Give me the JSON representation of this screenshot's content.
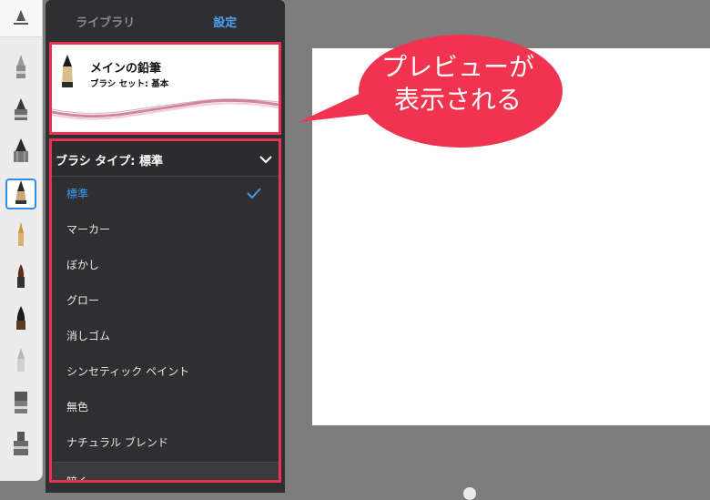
{
  "panel": {
    "tabs": [
      {
        "label": "ライブラリ",
        "active": false
      },
      {
        "label": "設定",
        "active": true
      }
    ],
    "preview": {
      "brush_name": "メインの鉛筆",
      "brush_set": "ブラシ セット: 基本"
    },
    "brush_type": {
      "header": "ブラシ タイプ: 標準",
      "options": [
        "標準",
        "マーカー",
        "ぼかし",
        "グロー",
        "消しゴム",
        "シンセティック ペイント",
        "無色",
        "ナチュラル ブレンド"
      ],
      "selected": "標準",
      "more": "暗く"
    }
  },
  "callout": {
    "line1": "プレビューが",
    "line2": "表示される"
  },
  "toolbar": {
    "icons": [
      "pencil-settings-icon",
      "airbrush-icon",
      "marker-icon",
      "pencil-icon",
      "ballpoint-icon",
      "pen-icon",
      "paintbrush-icon",
      "ink-brush-icon",
      "smudge-icon",
      "eraser-icon",
      "fill-icon"
    ],
    "selected": "ballpoint-icon"
  },
  "colors": {
    "accent": "#3c9af2",
    "highlight": "#e8344e",
    "panel": "#2f2f31",
    "background": "#7d7d7d"
  }
}
